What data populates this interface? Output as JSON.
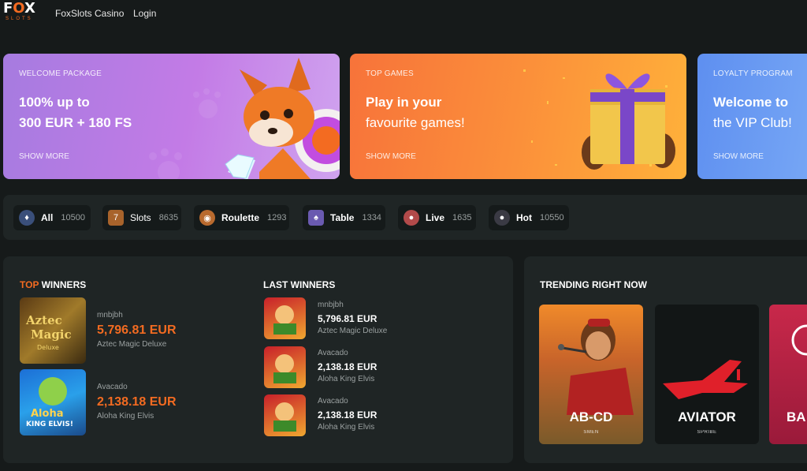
{
  "header": {
    "logo_text_1": "F",
    "logo_text_2": "O",
    "logo_text_3": "X",
    "logo_sub": "SLOTS",
    "nav": [
      "FoxSlots Casino",
      "Login"
    ]
  },
  "banners": [
    {
      "kicker": "WELCOME PACKAGE",
      "line1": "100% up to",
      "line2": "300 EUR + 180 FS",
      "more": "SHOW MORE"
    },
    {
      "kicker": "TOP GAMES",
      "line1": "Play in your",
      "line2": "favourite games!",
      "more": "SHOW MORE"
    },
    {
      "kicker": "LOYALTY PROGRAM",
      "line1": "Welcome to",
      "line2": "the VIP Club!",
      "more": "SHOW MORE"
    }
  ],
  "categories": [
    {
      "label": "All",
      "count": "10500",
      "icon": "all-games-icon"
    },
    {
      "label": "Slots",
      "count": "8635",
      "icon": "slots-icon"
    },
    {
      "label": "Roulette",
      "count": "1293",
      "icon": "roulette-icon"
    },
    {
      "label": "Table",
      "count": "1334",
      "icon": "cards-icon"
    },
    {
      "label": "Live",
      "count": "1635",
      "icon": "live-dealer-icon"
    },
    {
      "label": "Hot",
      "count": "10550",
      "icon": "bomb-icon"
    }
  ],
  "top_winners": {
    "title_accent": "TOP",
    "title_rest": " WINNERS",
    "items": [
      {
        "user": "mnbjbh",
        "amount": "5,796.81 EUR",
        "game": "Aztec Magic Deluxe"
      },
      {
        "user": "Avacado",
        "amount": "2,138.18 EUR",
        "game": "Aloha King Elvis"
      }
    ]
  },
  "last_winners": {
    "title": "LAST WINNERS",
    "items": [
      {
        "user": "mnbjbh",
        "amount": "5,796.81 EUR",
        "game": "Aztec Magic Deluxe"
      },
      {
        "user": "Avacado",
        "amount": "2,138.18 EUR",
        "game": "Aloha King Elvis"
      },
      {
        "user": "Avacado",
        "amount": "2,138.18 EUR",
        "game": "Aloha King Elvis"
      }
    ]
  },
  "trending": {
    "title": "TRENDING RIGHT NOW",
    "cards": [
      {
        "name": "AB-CD",
        "provider": "SMEN"
      },
      {
        "name": "AVIATOR",
        "provider": "SPRIBE"
      },
      {
        "name": "BA",
        "provider": ""
      }
    ]
  },
  "colors": {
    "accent": "#f36b21",
    "background": "#161a1a",
    "panel": "#1f2525"
  }
}
